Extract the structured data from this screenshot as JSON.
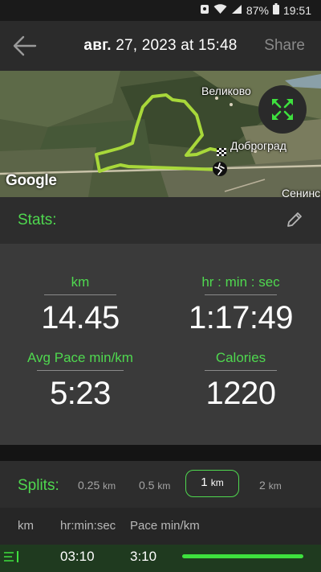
{
  "status_bar": {
    "battery": "87%",
    "time": "19:51"
  },
  "header": {
    "back_icon": "arrow-left-icon",
    "title_month": "авг.",
    "title_rest": " 27, 2023 at 15:48",
    "share_label": "Share"
  },
  "map": {
    "labels": {
      "velikovo": "Великово",
      "dobrograd": "Доброград",
      "seninsk": "Сенинск"
    },
    "google_label": "Google",
    "expand_icon": "expand-arrows-icon",
    "route_color": "#a8d83a"
  },
  "stats": {
    "title": "Stats:",
    "edit_icon": "pencil-icon",
    "items": [
      {
        "label": "km",
        "value": "14.45"
      },
      {
        "label": "hr : min : sec",
        "value": "1:17:49"
      },
      {
        "label": "Avg Pace min/km",
        "value": "5:23"
      },
      {
        "label": "Calories",
        "value": "1220"
      }
    ]
  },
  "splits": {
    "title": "Splits:",
    "options": [
      {
        "num": "0.25",
        "unit": "km"
      },
      {
        "num": "0.5",
        "unit": "km"
      },
      {
        "num": "1",
        "unit": "km",
        "selected": true
      },
      {
        "num": "2",
        "unit": "km"
      }
    ]
  },
  "table": {
    "headers": [
      "km",
      "hr:min:sec",
      "Pace min/km"
    ],
    "rows": [
      {
        "km": "",
        "time": "03:10",
        "pace": "3:10",
        "bar_fraction": 1.0
      }
    ]
  },
  "colors": {
    "accent": "#4fd84f",
    "background": "#141414",
    "panel": "#3a3a3a"
  }
}
